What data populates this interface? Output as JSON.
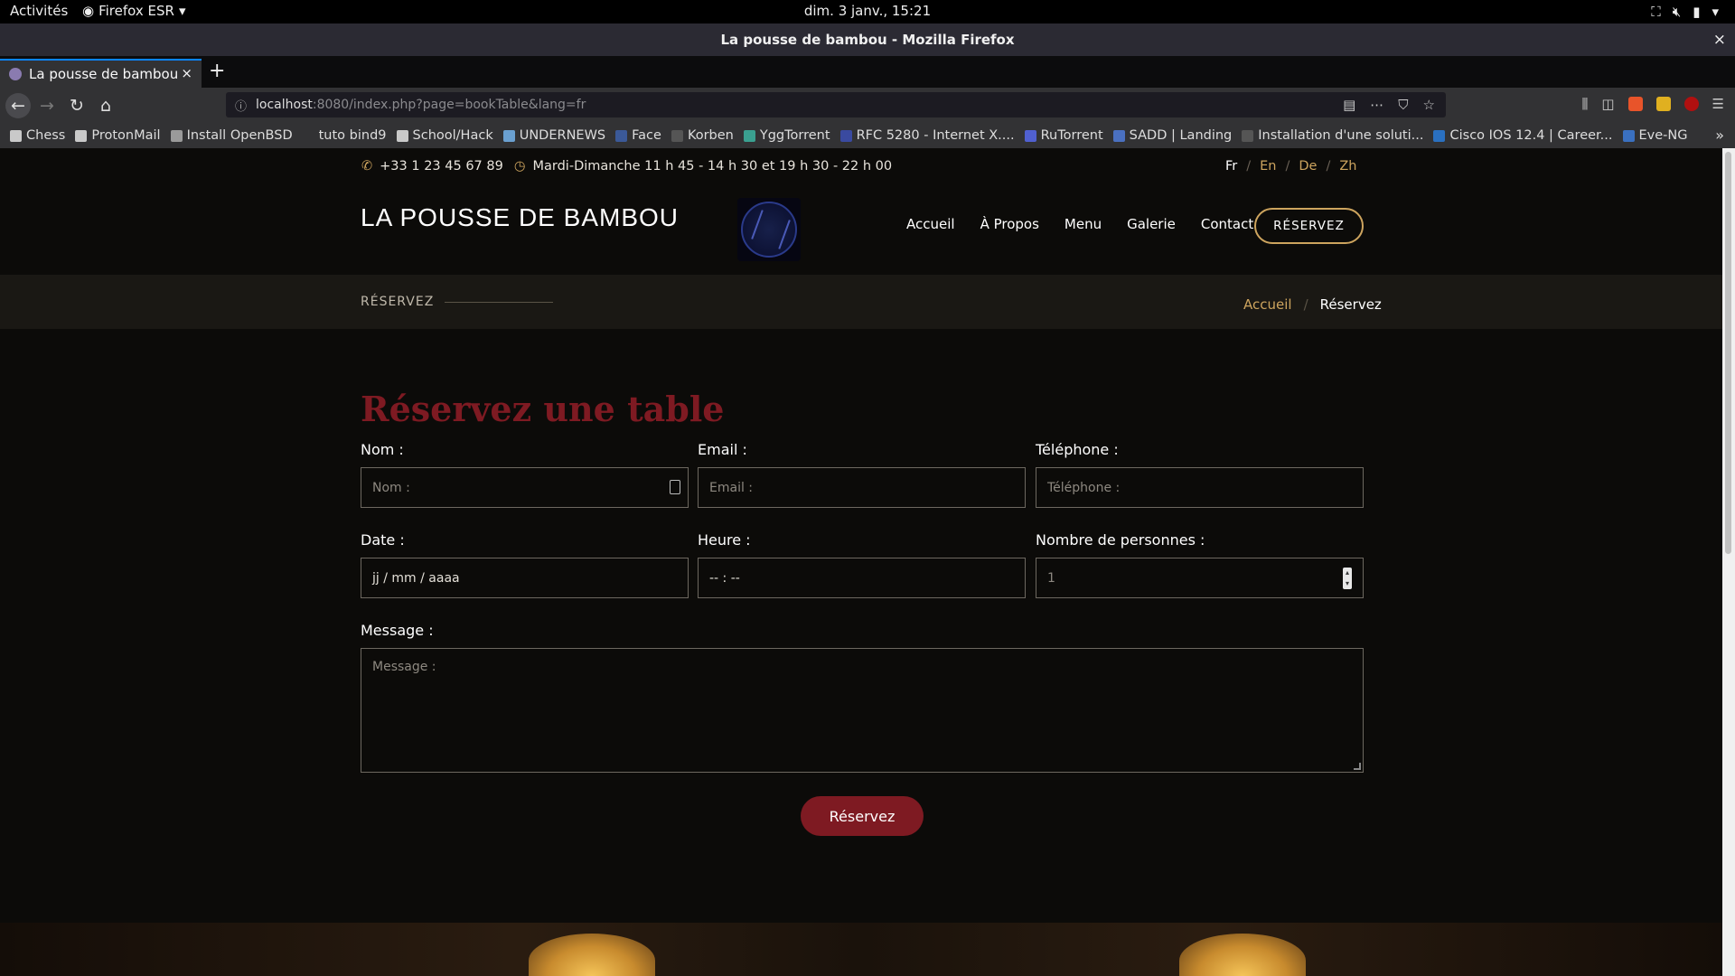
{
  "system_bar": {
    "activities": "Activités",
    "app_name": "Firefox ESR",
    "clock": "dim.  3 janv., 15:21"
  },
  "window": {
    "title": "La pousse de bambou - Mozilla Firefox",
    "close": "×"
  },
  "tab": {
    "title": "La pousse de bambou",
    "close": "×",
    "new": "+"
  },
  "url": {
    "host": "localhost",
    "path": ":8080/index.php?page=bookTable&lang=fr"
  },
  "bookmarks": [
    {
      "label": "Chess",
      "color": "#c9c9c9"
    },
    {
      "label": "ProtonMail",
      "color": "#c9c9c9"
    },
    {
      "label": "Install OpenBSD",
      "color": "#9a9a9a"
    },
    {
      "label": "tuto bind9",
      "color": "#323234"
    },
    {
      "label": "School/Hack",
      "color": "#c9c9c9"
    },
    {
      "label": "UNDERNEWS",
      "color": "#6aa0d0"
    },
    {
      "label": "Face",
      "color": "#3b5998"
    },
    {
      "label": "Korben",
      "color": "#555555"
    },
    {
      "label": "YggTorrent",
      "color": "#3aa090"
    },
    {
      "label": "RFC 5280 - Internet X....",
      "color": "#3a4aa0"
    },
    {
      "label": "RuTorrent",
      "color": "#5060d0"
    },
    {
      "label": "SADD | Landing",
      "color": "#4a70c0"
    },
    {
      "label": "Installation d'une soluti...",
      "color": "#555555"
    },
    {
      "label": "Cisco IOS 12.4 | Career...",
      "color": "#2a70c0"
    },
    {
      "label": "Eve-NG",
      "color": "#3a70c0"
    }
  ],
  "site": {
    "phone": "+33 1 23 45 67 89",
    "hours": "Mardi-Dimanche 11 h 45 - 14 h 30 et 19 h 30 - 22 h 00",
    "langs": [
      "Fr",
      "En",
      "De",
      "Zh"
    ],
    "lang_sep": "/",
    "brand": "LA POUSSE DE BAMBOU",
    "menu": [
      "Accueil",
      "À Propos",
      "Menu",
      "Galerie",
      "Contact"
    ],
    "book_button": "RÉSERVEZ",
    "breadcrumb_title": "RÉSERVEZ",
    "breadcrumb_home": "Accueil",
    "breadcrumb_sep": "/",
    "breadcrumb_current": "Réservez",
    "accent": "#cda45e",
    "brand_red": "#7e1a22"
  },
  "form": {
    "heading": "Réservez une table",
    "name_label": "Nom :",
    "name_placeholder": "Nom :",
    "email_label": "Email :",
    "email_placeholder": "Email :",
    "phone_label": "Téléphone :",
    "phone_placeholder": "Téléphone :",
    "date_label": "Date :",
    "date_value": "jj / mm / aaaa",
    "time_label": "Heure :",
    "time_value": "-- : --",
    "people_label": "Nombre de personnes :",
    "people_value": "1",
    "message_label": "Message :",
    "message_placeholder": "Message :",
    "submit": "Réservez"
  }
}
